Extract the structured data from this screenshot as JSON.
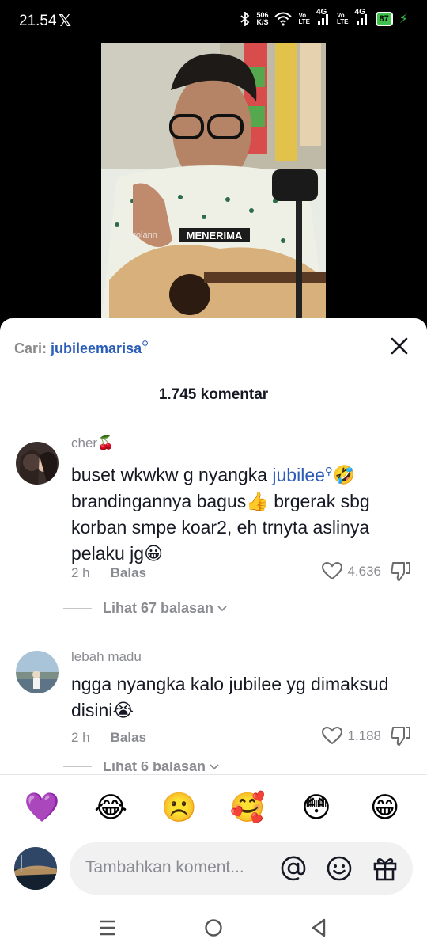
{
  "status_bar": {
    "time": "21.54",
    "x_app": "𝕏",
    "net_speed_value": "506",
    "net_speed_unit": "K/S",
    "sim1_tech": "Vo\nLTE",
    "sim1_net": "4G",
    "sim2_tech": "Vo\nLTE",
    "sim2_net": "4G",
    "battery": "87"
  },
  "video": {
    "caption": "MENERIMA",
    "watermark": "obrolann"
  },
  "search": {
    "prefix": "Cari:",
    "term": "jubileemarisa"
  },
  "comment_count": "1.745 komentar",
  "comments": [
    {
      "user": "cher🍒",
      "text_before": "buset wkwkw g nyangka ",
      "mention": "jubilee",
      "text_after": "🤣 brandingannya bagus👍 brgerak sbg korban smpe koar2, eh trnyta aslinya pelaku jg😀",
      "time": "2 h",
      "reply_label": "Balas",
      "likes": "4.636",
      "view_replies": "Lihat 67 balasan"
    },
    {
      "user": "lebah madu",
      "text": "ngga nyangka kalo jubilee yg dimaksud disini😭",
      "time": "2 h",
      "reply_label": "Balas",
      "likes": "1.188",
      "view_replies": "Lihat 6 balasan"
    }
  ],
  "emoji_bar": [
    "💜",
    "😂",
    "☹️",
    "🥰",
    "😳",
    "😁"
  ],
  "input": {
    "placeholder": "Tambahkan koment..."
  },
  "icons": [
    "close-icon",
    "heart-icon",
    "dislike-icon",
    "at-icon",
    "smiley-icon",
    "gift-icon",
    "menu-icon",
    "home-icon",
    "back-icon"
  ]
}
